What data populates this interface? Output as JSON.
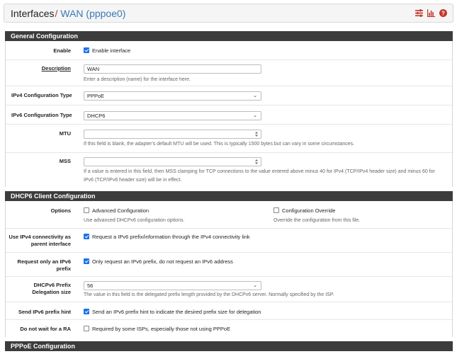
{
  "header": {
    "crumb_root": "Interfaces",
    "crumb_sep": "/",
    "crumb_current": "WAN (pppoe0)",
    "icons": [
      "settings-sliders-icon",
      "chart-icon",
      "help-icon"
    ],
    "accent_color": "#c0392b",
    "link_color": "#3c78b4"
  },
  "general": {
    "title": "General Configuration",
    "enable": {
      "label": "Enable",
      "text": "Enable interface",
      "checked": true
    },
    "description": {
      "label": "Description",
      "value": "WAN",
      "hint": "Enter a description (name) for the interface here."
    },
    "ipv4_type": {
      "label": "IPv4 Configuration Type",
      "value": "PPPoE"
    },
    "ipv6_type": {
      "label": "IPv6 Configuration Type",
      "value": "DHCP6"
    },
    "mtu": {
      "label": "MTU",
      "value": "",
      "hint": "If this field is blank, the adapter's default MTU will be used. This is typically 1500 bytes but can vary in some circumstances."
    },
    "mss": {
      "label": "MSS",
      "value": "",
      "hint": "If a value is entered in this field, then MSS clamping for TCP connections to the value entered above minus 40 for IPv4 (TCP/IPv4 header size) and minus 60 for IPv6 (TCP/IPv6 header size) will be in effect."
    }
  },
  "dhcp6": {
    "title": "DHCP6 Client Configuration",
    "options": {
      "label": "Options",
      "advanced": {
        "text": "Advanced Configuration",
        "hint": "Use advanced DHCPv6 configuration options.",
        "checked": false
      },
      "override": {
        "text": "Configuration Override",
        "hint": "Override the configuration from this file.",
        "checked": false
      }
    },
    "ipv4_parent": {
      "label_l1": "Use IPv4 connectivity as",
      "label_l2": "parent interface",
      "text": "Request a IPv6 prefix/information through the IPv4 connectivity link",
      "checked": true
    },
    "prefix_only": {
      "label_l1": "Request only an IPv6",
      "label_l2": "prefix",
      "text": "Only request an IPv6 prefix, do not request an IPv6 address",
      "checked": true
    },
    "delegation": {
      "label_l1": "DHCPv6 Prefix",
      "label_l2": "Delegation size",
      "value": "56",
      "hint": "The value in this field is the delegated prefix length provided by the DHCPv6 server. Normally specified by the ISP."
    },
    "prefix_hint": {
      "label": "Send IPv6 prefix hint",
      "text": "Send an IPv6 prefix hint to indicate the desired prefix size for delegation",
      "checked": true
    },
    "no_wait_ra": {
      "label": "Do not wait for a RA",
      "text": "Required by some ISPs, especially those not using PPPoE",
      "checked": false
    }
  },
  "pppoe": {
    "title": "PPPoE Configuration"
  }
}
